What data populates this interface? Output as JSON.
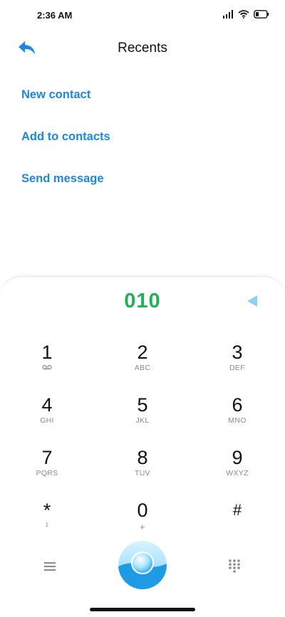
{
  "status_bar": {
    "time": "2:36 AM",
    "icons": [
      "signal-icon",
      "wifi-icon",
      "battery-icon"
    ]
  },
  "header": {
    "title": "Recents",
    "back_icon": "back-arrow-icon"
  },
  "menu": {
    "items": [
      {
        "label": "New contact"
      },
      {
        "label": "Add to contacts"
      },
      {
        "label": "Send message"
      }
    ]
  },
  "dialpad": {
    "number": "010",
    "accent": "#20b05a",
    "link_color": "#1c87e0",
    "keys": [
      {
        "digit": "1",
        "letters": ""
      },
      {
        "digit": "2",
        "letters": "ABC"
      },
      {
        "digit": "3",
        "letters": "DEF"
      },
      {
        "digit": "4",
        "letters": "GHI"
      },
      {
        "digit": "5",
        "letters": "JKL"
      },
      {
        "digit": "6",
        "letters": "MNO"
      },
      {
        "digit": "7",
        "letters": "PQRS"
      },
      {
        "digit": "8",
        "letters": "TUV"
      },
      {
        "digit": "9",
        "letters": "WXYZ"
      },
      {
        "digit": "*",
        "letters": "1"
      },
      {
        "digit": "0",
        "letters": "+"
      },
      {
        "digit": "#",
        "letters": ""
      }
    ]
  },
  "bottom_bar": {
    "icons": [
      "menu-icon",
      "call-icon",
      "keypad-icon"
    ]
  }
}
